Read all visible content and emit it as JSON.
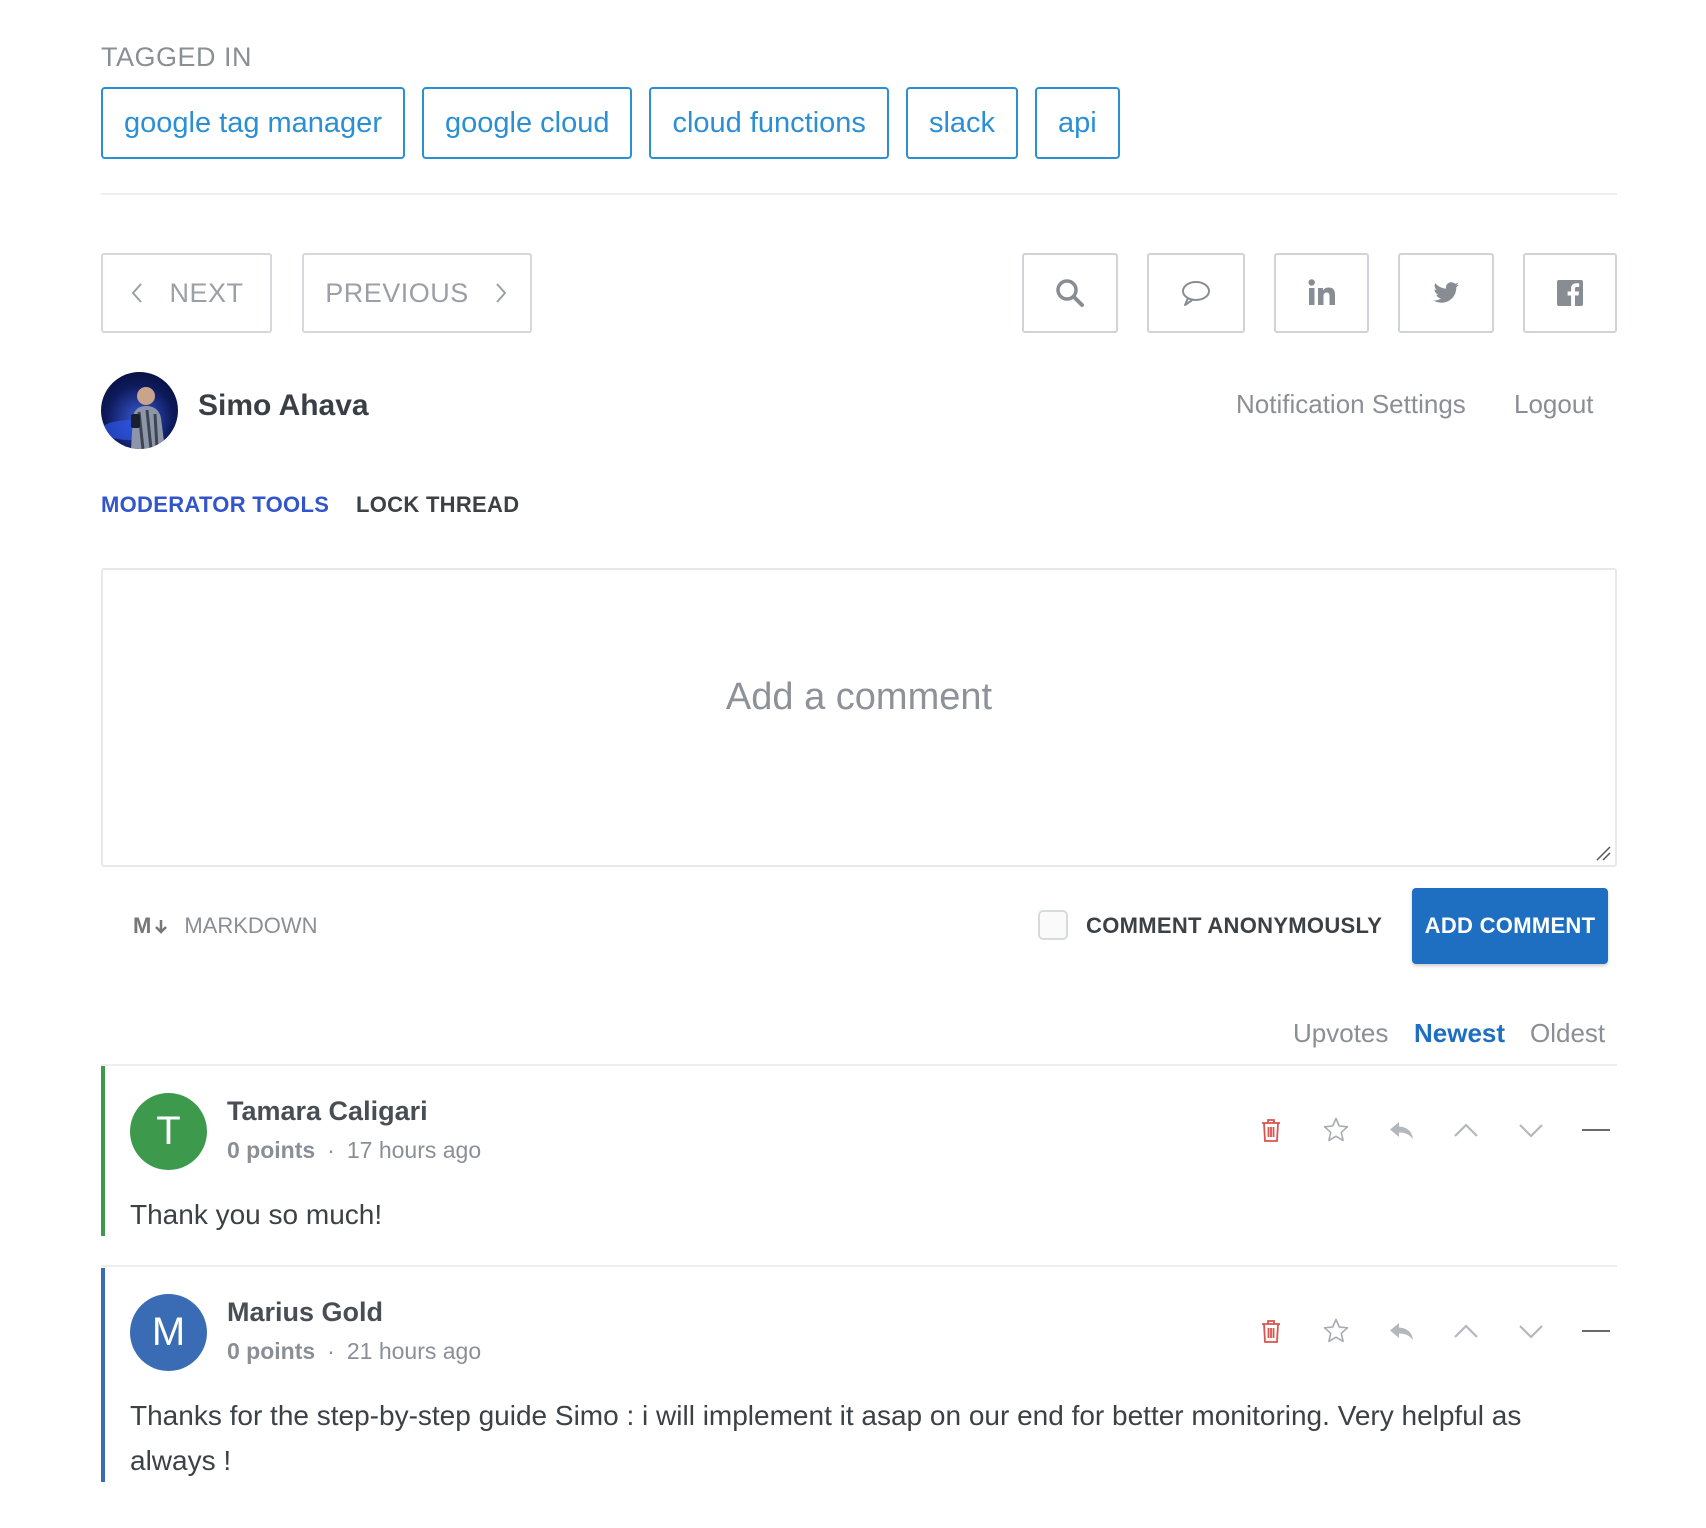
{
  "tags": {
    "label": "TAGGED IN",
    "items": [
      "google tag manager",
      "google cloud",
      "cloud functions",
      "slack",
      "api"
    ]
  },
  "nav": {
    "next_label": "NEXT",
    "previous_label": "PREVIOUS"
  },
  "share": {
    "icons": [
      "search-icon",
      "comment-icon",
      "linkedin-icon",
      "twitter-icon",
      "facebook-icon"
    ]
  },
  "user": {
    "name": "Simo Ahava",
    "notification_settings": "Notification Settings",
    "logout": "Logout"
  },
  "moderator": {
    "tools_label": "MODERATOR TOOLS",
    "lock_label": "LOCK THREAD"
  },
  "composer": {
    "placeholder": "Add a comment",
    "markdown_label": "MARKDOWN",
    "markdown_icon": "M",
    "anonymous_label": "COMMENT ANONYMOUSLY",
    "anonymous_checked": false,
    "submit_label": "ADD COMMENT"
  },
  "sort": {
    "options": [
      "Upvotes",
      "Newest",
      "Oldest"
    ],
    "active": "Newest"
  },
  "comments": [
    {
      "initial": "T",
      "author": "Tamara Caligari",
      "points": "0 points",
      "separator": "·",
      "time": "17 hours ago",
      "body": "Thank you so much!",
      "avatar_color": "#3d9a4d",
      "bar_color": "#3d9a4d"
    },
    {
      "initial": "M",
      "author": "Marius Gold",
      "points": "0 points",
      "separator": "·",
      "time": "21 hours ago",
      "body": "Thanks for the step-by-step guide Simo : i will implement it asap on our end for better monitoring. Very helpful as always !",
      "avatar_color": "#3a6bb5",
      "bar_color": "#3a6bb5"
    }
  ],
  "colors": {
    "accent": "#2a8fd4",
    "primary_button": "#1e6fc2",
    "moderator_link": "#3355cc",
    "delete_icon": "#d9534f"
  }
}
